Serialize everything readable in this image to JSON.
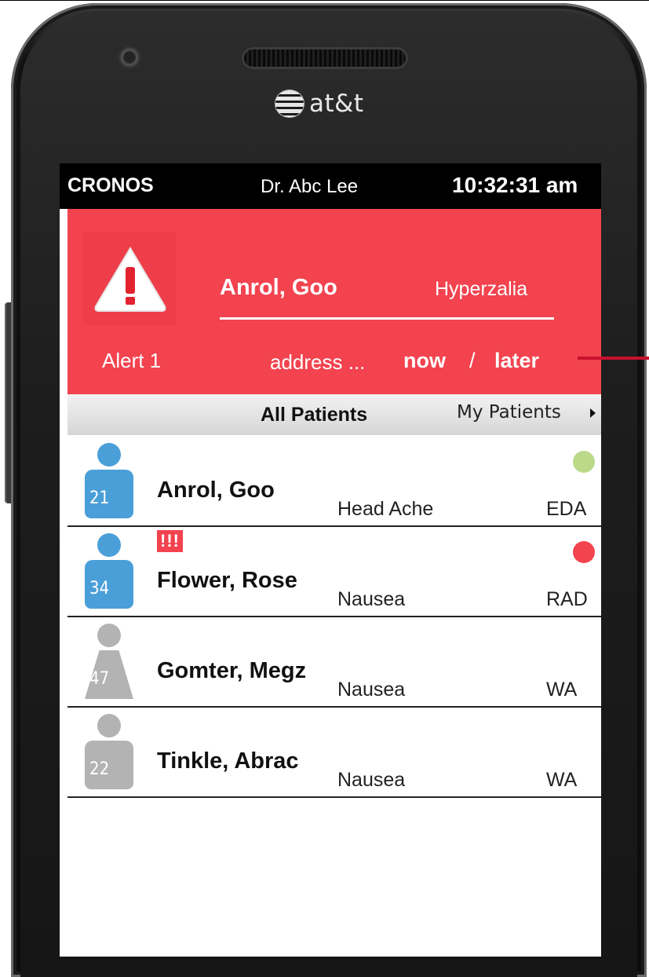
{
  "carrier": {
    "name": "at&t",
    "icon": "att-globe-icon"
  },
  "status_bar": {
    "app": "CRONOS",
    "doctor": "Dr. Abc Lee",
    "time": "10:32:31 am"
  },
  "alert": {
    "label": "Alert 1",
    "patient": "Anrol, Goo",
    "condition": "Hyperzalia",
    "address_text": "address ...",
    "now_label": "now",
    "separator": "/",
    "later_label": "later",
    "icon": "warning-triangle-icon",
    "color": "#f2434f"
  },
  "tabs": {
    "all": "All Patients",
    "mine": "My Patients"
  },
  "patients": [
    {
      "name": "Anrol, Goo",
      "age": "21",
      "complaint": "Head Ache",
      "dept": "EDA",
      "avatar_color": "#4a9fd8",
      "gender": "male",
      "status_color": "#bcd98a",
      "flag": ""
    },
    {
      "name": "Flower, Rose",
      "age": "34",
      "complaint": "Nausea",
      "dept": "RAD",
      "avatar_color": "#4a9fd8",
      "gender": "male",
      "status_color": "#f2434f",
      "flag": "!!!"
    },
    {
      "name": "Gomter, Megz",
      "age": "47",
      "complaint": "Nausea",
      "dept": "WA",
      "avatar_color": "#b3b3b3",
      "gender": "female",
      "status_color": "",
      "flag": ""
    },
    {
      "name": "Tinkle, Abrac",
      "age": "22",
      "complaint": "Nausea",
      "dept": "WA",
      "avatar_color": "#b3b3b3",
      "gender": "male",
      "status_color": "",
      "flag": ""
    }
  ],
  "dock": [
    {
      "icon": "purple-app-icon",
      "color": "#8a4fb3"
    },
    {
      "icon": "tan-app-icon",
      "color": "#c49a86"
    },
    {
      "icon": "blue-app-icon",
      "color": "#4a9fd8"
    },
    {
      "icon": "red-app-icon",
      "color": "#f2434f"
    }
  ]
}
